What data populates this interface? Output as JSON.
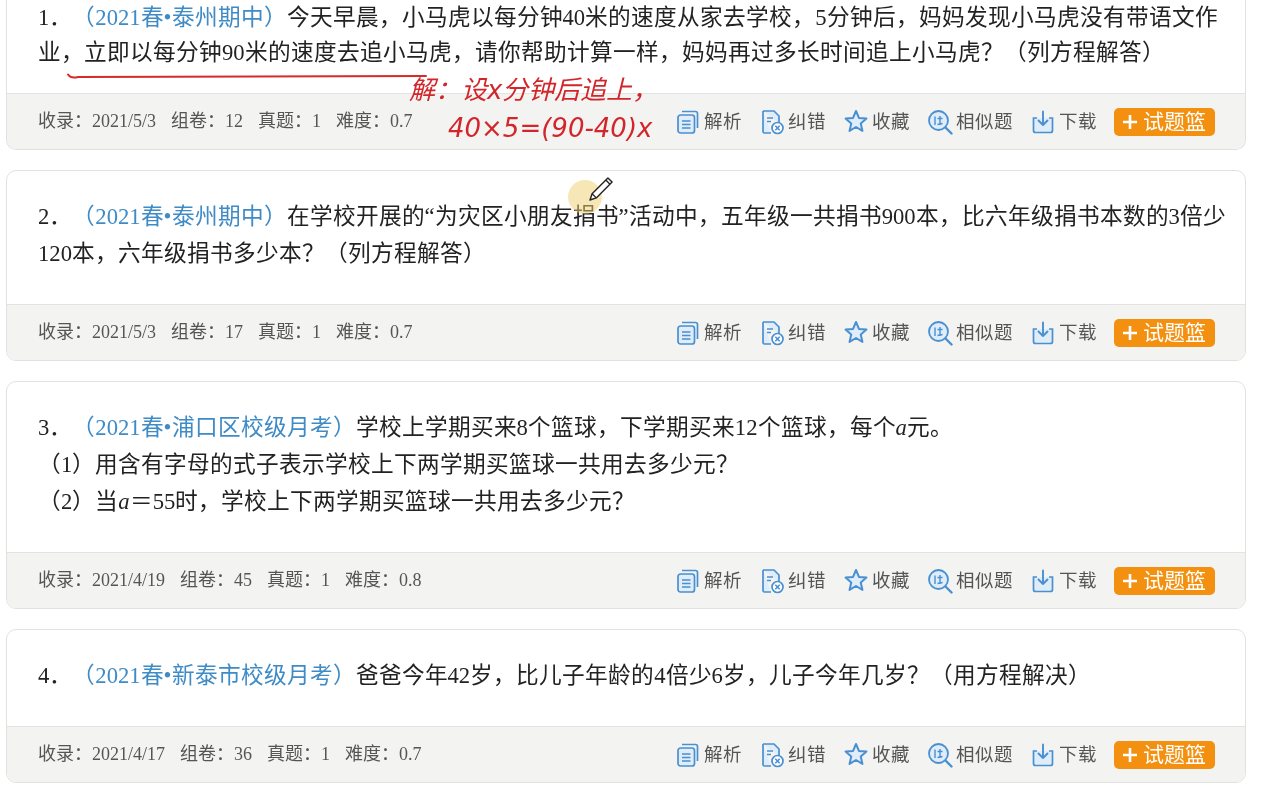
{
  "questions": [
    {
      "number": "1．",
      "source": "（2021春•泰州期中）",
      "text": [
        "今天早晨，小马虎以每分钟40米的速度从家去学校，5分钟后，妈妈发现小马虎没有带语文作业，立即以每分钟90米的速度去追小马虎，请你帮助计算一样，妈妈再过多长时间追上小马虎？（列方程解答）"
      ],
      "handwriting": [
        "解：设x分钟后追上，",
        "40×5=(90-40)x"
      ],
      "stats": [
        "收录：2021/5/3",
        "组卷：12",
        "真题：1",
        "难度：0.7"
      ],
      "actions": [
        {
          "kind": "analysis",
          "label": "解析"
        },
        {
          "kind": "report",
          "label": "纠错"
        },
        {
          "kind": "favorite",
          "label": "收藏"
        },
        {
          "kind": "similar",
          "label": "相似题"
        },
        {
          "kind": "download",
          "label": "下载"
        }
      ],
      "basket_button": "试题篮"
    },
    {
      "number": "2．",
      "source": "（2021春•泰州期中）",
      "text": [
        "在学校开展的“为灾区小朋友捐书”活动中，五年级一共捐书900本，比六年级捐书本数的3倍少120本，六年级捐书多少本？（列方程解答）"
      ],
      "stats": [
        "收录：2021/5/3",
        "组卷：17",
        "真题：1",
        "难度：0.7"
      ],
      "actions": [
        {
          "kind": "analysis",
          "label": "解析"
        },
        {
          "kind": "report",
          "label": "纠错"
        },
        {
          "kind": "favorite",
          "label": "收藏"
        },
        {
          "kind": "similar",
          "label": "相似题"
        },
        {
          "kind": "download",
          "label": "下载"
        }
      ],
      "basket_button": "试题篮"
    },
    {
      "number": "3．",
      "source": "（2021春•浦口区校级月考）",
      "text": [
        "学校上学期买来8个篮球，下学期买来12个篮球，每个",
        {
          "italic": "a"
        },
        "元。"
      ],
      "parts": [
        [
          "（1）用含有字母的式子表示学校上下两学期买篮球一共用去多少元？"
        ],
        [
          "（2）当",
          {
            "italic": "a"
          },
          "＝55时，学校上下两学期买篮球一共用去多少元？"
        ]
      ],
      "stats": [
        "收录：2021/4/19",
        "组卷：45",
        "真题：1",
        "难度：0.8"
      ],
      "actions": [
        {
          "kind": "analysis",
          "label": "解析"
        },
        {
          "kind": "report",
          "label": "纠错"
        },
        {
          "kind": "favorite",
          "label": "收藏"
        },
        {
          "kind": "similar",
          "label": "相似题"
        },
        {
          "kind": "download",
          "label": "下载"
        }
      ],
      "basket_button": "试题篮"
    },
    {
      "number": "4．",
      "source": "（2021春•新泰市校级月考）",
      "text": [
        "爸爸今年42岁，比儿子年龄的4倍少6岁，儿子今年几岁？（用方程解决）"
      ],
      "stats": [
        "收录：2021/4/17",
        "组卷：36",
        "真题：1",
        "难度：0.7"
      ],
      "actions": [
        {
          "kind": "analysis",
          "label": "解析"
        },
        {
          "kind": "report",
          "label": "纠错"
        },
        {
          "kind": "favorite",
          "label": "收藏"
        },
        {
          "kind": "similar",
          "label": "相似题"
        },
        {
          "kind": "download",
          "label": "下载"
        }
      ],
      "basket_button": "试题篮"
    }
  ]
}
